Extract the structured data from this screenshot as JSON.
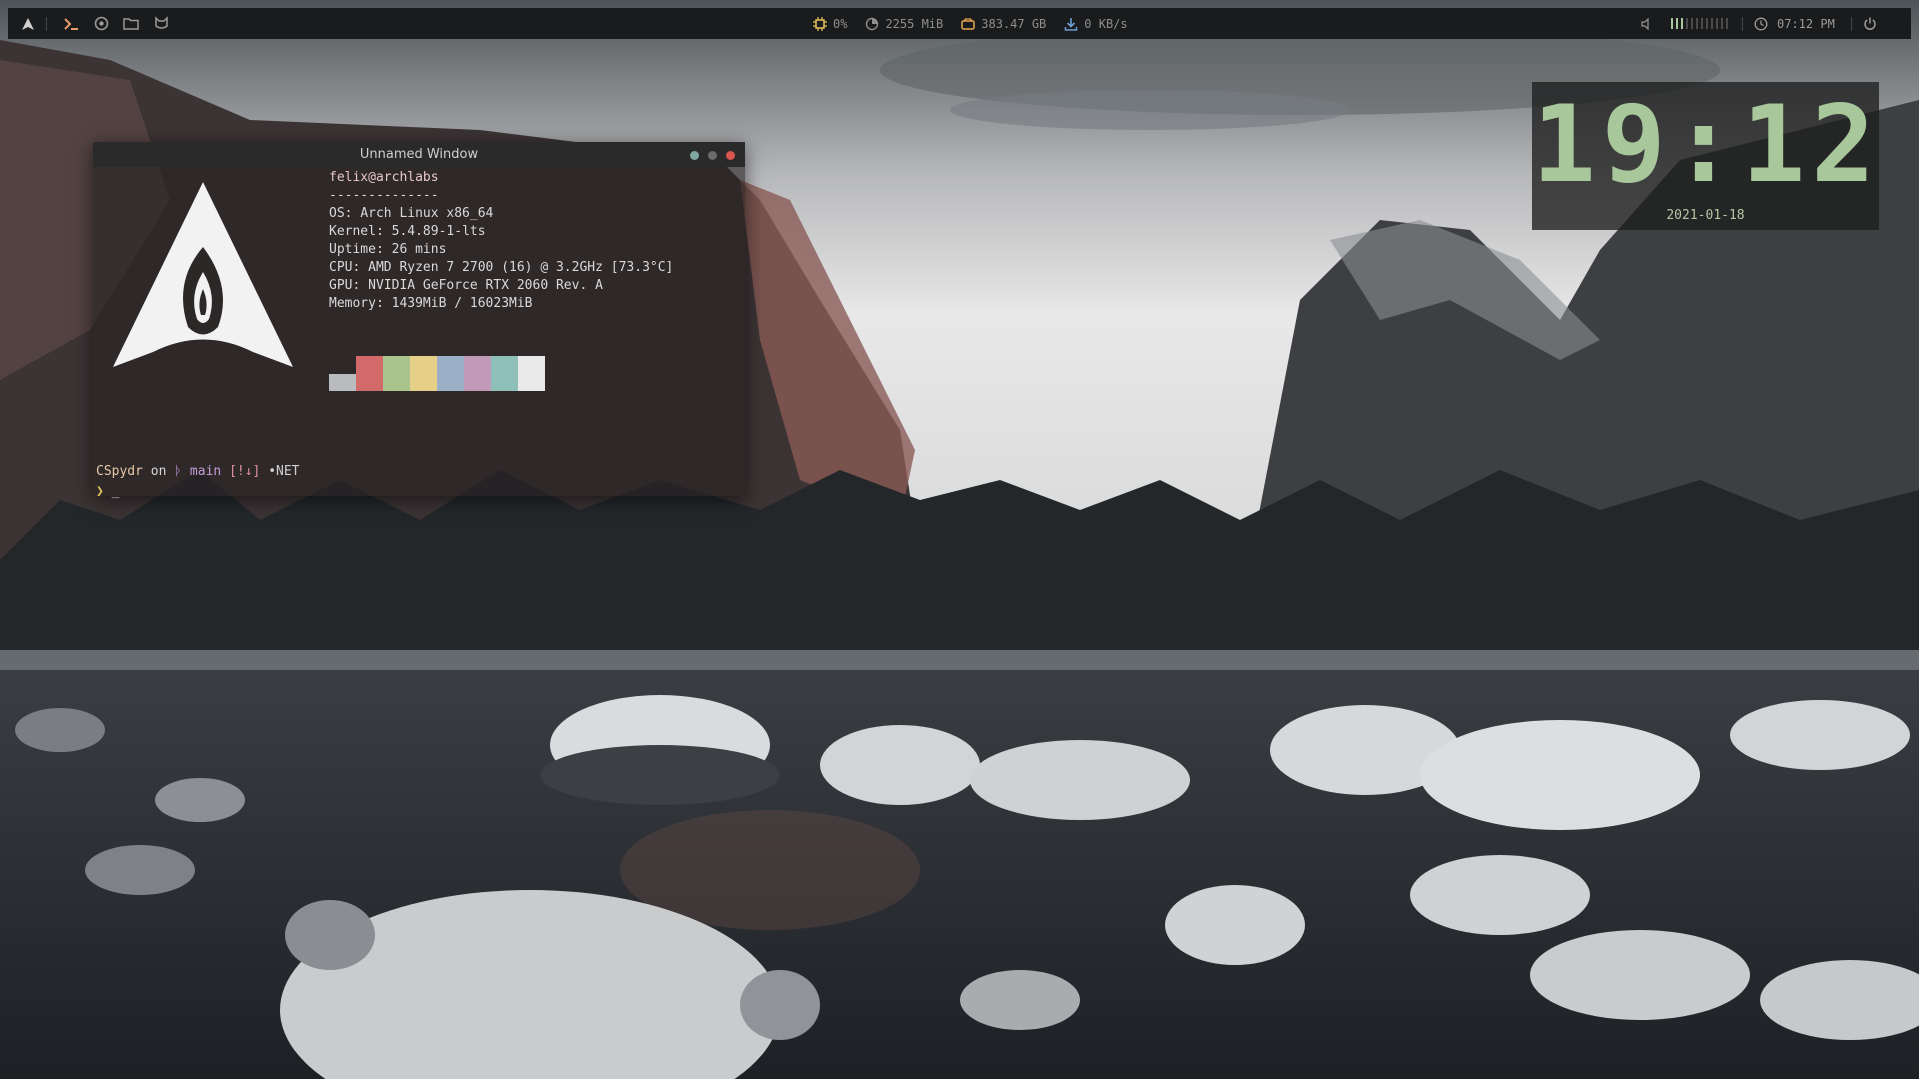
{
  "topbar": {
    "left_icons": [
      "arch-menu-icon",
      "terminal-icon",
      "browser-icon",
      "folder-icon",
      "cat-icon"
    ],
    "stats": {
      "cpu": "0%",
      "memory": "2255 MiB",
      "disk": "383.47 GB",
      "network": "0 KB/s"
    },
    "volume_level": 0.25,
    "time": "07:12 PM"
  },
  "terminal": {
    "title": "Unnamed Window",
    "user_host": "felix@archlabs",
    "separator": "--------------",
    "os_label": "OS:",
    "os": "Arch Linux x86_64",
    "kernel_label": "Kernel:",
    "kernel": "5.4.89-1-lts",
    "uptime_label": "Uptime:",
    "uptime": "26 mins",
    "cpu_label": "CPU:",
    "cpu": "AMD Ryzen 7 2700 (16) @ 3.2GHz [73.3°C]",
    "gpu_label": "GPU:",
    "gpu": "NVIDIA GeForce RTX 2060 Rev. A",
    "memory_label": "Memory:",
    "memory": "1439MiB / 16023MiB",
    "palette": [
      "#b8bcbe",
      "#d26a6a",
      "#a9c48d",
      "#e6cf86",
      "#9bb0c6",
      "#c09ab7",
      "#8fbfb9",
      "#e9e9e9"
    ],
    "prompt": {
      "dir": "CSpydr",
      "on": "on",
      "branch_icon": "ᚦ",
      "branch": "main",
      "status": "[!↓]",
      "env": "•NET",
      "symbol": "❯",
      "cursor": "_"
    }
  },
  "clock": {
    "time": "19:12",
    "date": "2021-01-18"
  },
  "colors": {
    "accent_green": "#a8c79a",
    "bar_bg": "#1a1b1c",
    "prompt_pink": "#e18fa6",
    "branch_purple": "#c59bd6"
  }
}
